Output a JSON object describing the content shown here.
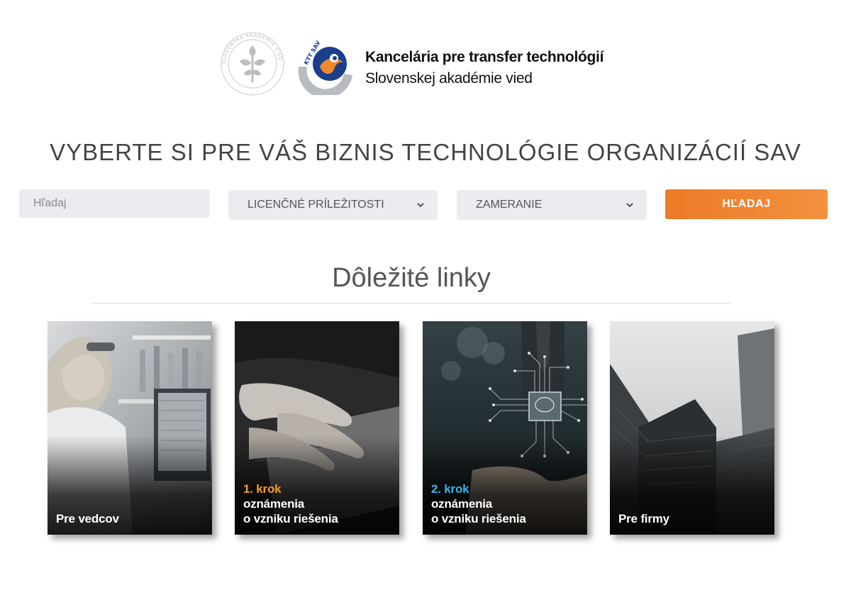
{
  "header": {
    "org_line1": "Kancelária pre transfer technológií",
    "org_line2": "Slovenskej akadémie vied",
    "ktt_logo_text": "KTT SAV",
    "sav_logo_ring_text": "SLOVENSKÁ AKADÉMIA VIED"
  },
  "page_title": "VYBERTE SI PRE VÁŠ BIZNIS TECHNOLÓGIE ORGANIZÁCIÍ SAV",
  "search": {
    "placeholder": "Hľadaj",
    "licence_select": "LICENČNÉ PRÍLEŽITOSTI",
    "focus_select": "ZAMERANIE",
    "button_label": "HĽADAJ"
  },
  "links": {
    "heading": "Dôležité linky",
    "cards": [
      {
        "title": "Pre vedcov"
      },
      {
        "step": "1. krok",
        "line1": "oznámenia",
        "line2": "o vzniku riešenia"
      },
      {
        "step": "2. krok",
        "line1": "oznámenia",
        "line2": "o vzniku riešenia"
      },
      {
        "title": "Pre firmy"
      }
    ]
  },
  "colors": {
    "accent_orange": "#ec7a26",
    "step_orange": "#f59a2b",
    "step_blue": "#37b6e8",
    "field_bg": "#ebecef",
    "ktt_blue": "#1b3f8c"
  },
  "icons": {
    "select_chevron": "chevron-down-icon",
    "sav_logo": "sav-emblem-icon",
    "ktt_logo": "ktt-logo-icon"
  }
}
